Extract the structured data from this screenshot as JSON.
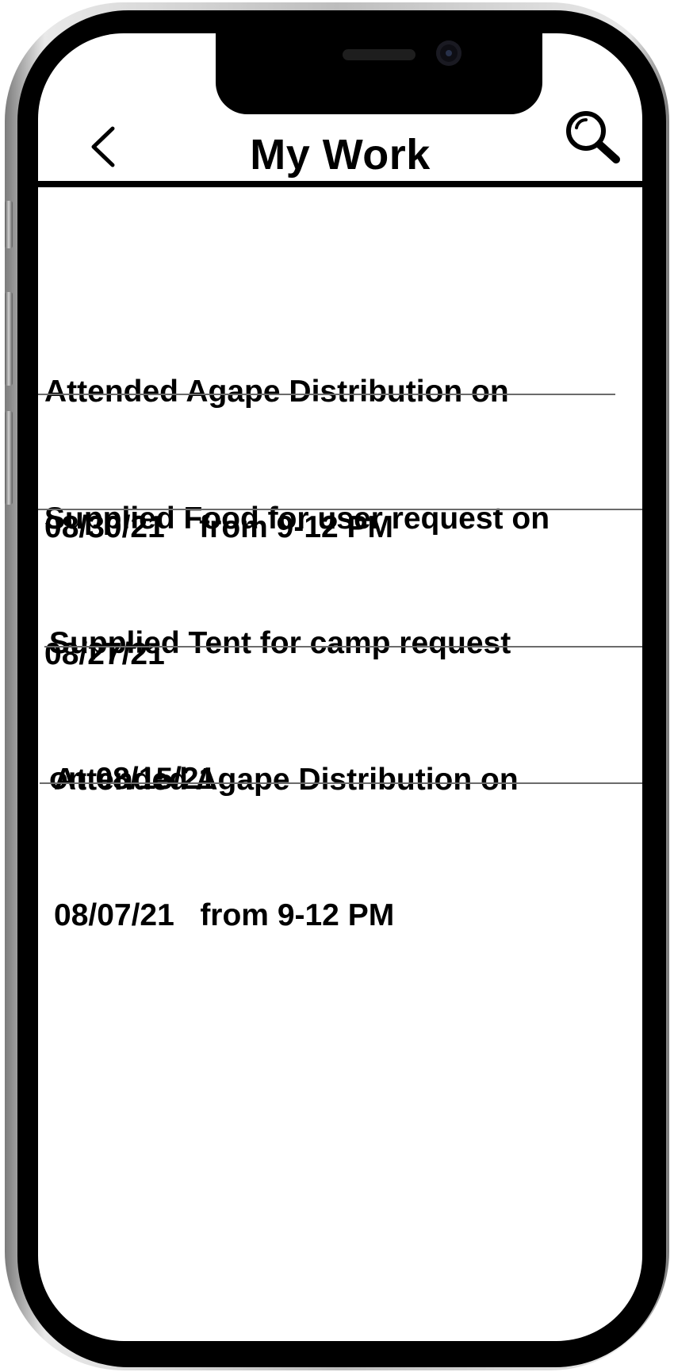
{
  "app": {
    "title": "My Work",
    "icons": {
      "back": "chevron-left-icon",
      "search": "search-icon"
    }
  },
  "work_items": [
    {
      "line1": "Attended Agape Distribution on",
      "line2": "08/30/21    from 9-12 PM"
    },
    {
      "line1": "Supplied Food for user request on",
      "line2": "08/27/21"
    },
    {
      "line1": "Supplied Tent for camp request",
      "line2": "on 08/15/21"
    },
    {
      "line1": "Attended Agape Distribution on",
      "line2": "08/07/21   from 9-12 PM"
    }
  ]
}
